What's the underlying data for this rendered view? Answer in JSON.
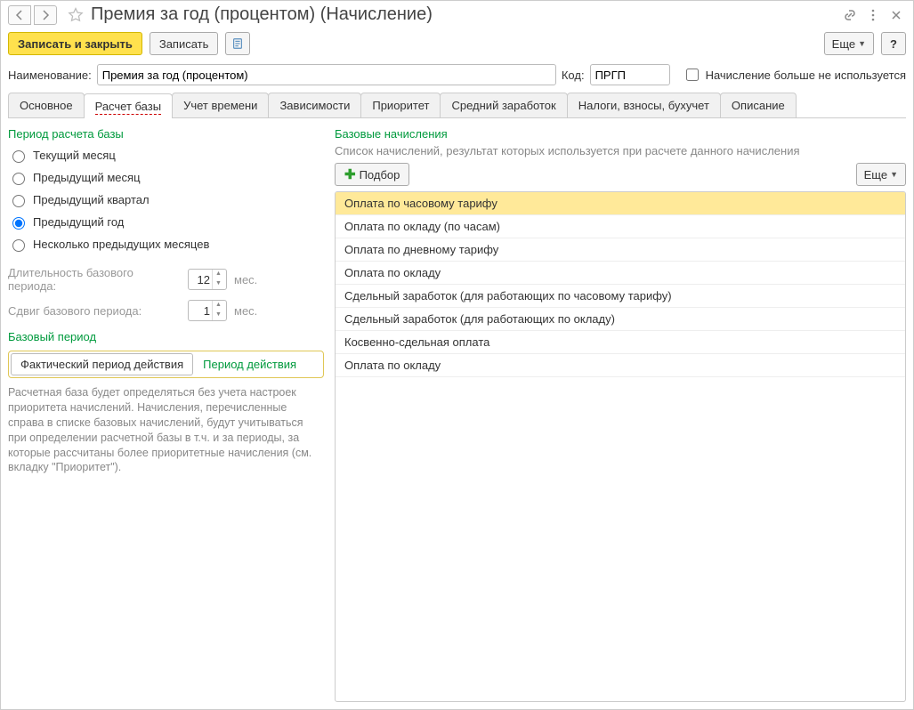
{
  "title": "Премия за год (процентом) (Начисление)",
  "cmdbar": {
    "save_close": "Записать и закрыть",
    "save": "Записать",
    "more": "Еще",
    "help": "?"
  },
  "form": {
    "name_label": "Наименование:",
    "name_value": "Премия за год (процентом)",
    "code_label": "Код:",
    "code_value": "ПРГП",
    "not_used_label": "Начисление больше не используется"
  },
  "tabs": [
    "Основное",
    "Расчет базы",
    "Учет времени",
    "Зависимости",
    "Приоритет",
    "Средний заработок",
    "Налоги, взносы, бухучет",
    "Описание"
  ],
  "active_tab": 1,
  "left": {
    "period_title": "Период расчета базы",
    "radios": [
      "Текущий месяц",
      "Предыдущий месяц",
      "Предыдущий квартал",
      "Предыдущий год",
      "Несколько предыдущих месяцев"
    ],
    "radio_selected": 3,
    "duration_label": "Длительность базового периода:",
    "duration_value": "12",
    "duration_unit": "мес.",
    "shift_label": "Сдвиг базового периода:",
    "shift_value": "1",
    "shift_unit": "мес.",
    "base_period_title": "Базовый период",
    "seg_actual": "Фактический период действия",
    "seg_action": "Период действия",
    "description": "Расчетная база будет определяться без учета настроек приоритета начислений. Начисления, перечисленные справа в списке базовых начислений, будут учитываться при определении расчетной базы в т.ч. и за периоды, за которые рассчитаны более приоритетные начисления (см. вкладку \"Приоритет\")."
  },
  "right": {
    "title": "Базовые начисления",
    "hint": "Список начислений, результат которых используется при расчете данного начисления",
    "select_btn": "Подбор",
    "more": "Еще",
    "rows": [
      "Оплата по часовому тарифу",
      "Оплата по окладу (по часам)",
      "Оплата по дневному тарифу",
      "Оплата по окладу",
      "Сдельный заработок (для работающих по часовому тарифу)",
      "Сдельный заработок (для работающих по окладу)",
      "Косвенно-сдельная оплата",
      "Оплата по окладу"
    ],
    "selected_row": 0
  }
}
